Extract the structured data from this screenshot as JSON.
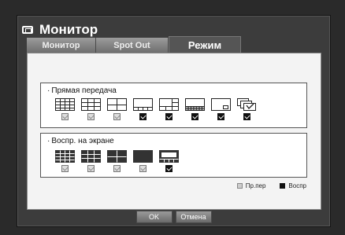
{
  "window": {
    "title": "Монитор",
    "icon": "monitor-icon"
  },
  "tabs": [
    {
      "label": "Монитор",
      "active": false
    },
    {
      "label": "Spot Out",
      "active": false
    },
    {
      "label": "Режим",
      "active": true
    }
  ],
  "live_group": {
    "title": "Прямая передача",
    "options": [
      {
        "icon": "grid-16-layout-icon",
        "checked": false
      },
      {
        "icon": "grid-9-layout-icon",
        "checked": false
      },
      {
        "icon": "grid-4-layout-icon",
        "checked": false
      },
      {
        "icon": "layout-1-plus-7-icon",
        "checked": true
      },
      {
        "icon": "layout-1-plus-5-icon",
        "checked": true
      },
      {
        "icon": "layout-1-plus-12-icon",
        "checked": true
      },
      {
        "icon": "pip-layout-icon",
        "checked": true
      },
      {
        "icon": "sequence-layout-icon",
        "checked": true
      }
    ]
  },
  "playback_group": {
    "title": "Воспр. на экране",
    "options": [
      {
        "icon": "grid-16-layout-icon",
        "checked": false
      },
      {
        "icon": "grid-9-layout-icon",
        "checked": false
      },
      {
        "icon": "grid-4-layout-icon",
        "checked": false
      },
      {
        "icon": "single-layout-icon",
        "checked": false
      },
      {
        "icon": "layout-1-plus-7-icon",
        "checked": true
      }
    ]
  },
  "legend": {
    "inactive_label": "Пр.пер",
    "active_label": "Воспр"
  },
  "footer": {
    "ok_label": "OK",
    "cancel_label": "Отмена"
  }
}
